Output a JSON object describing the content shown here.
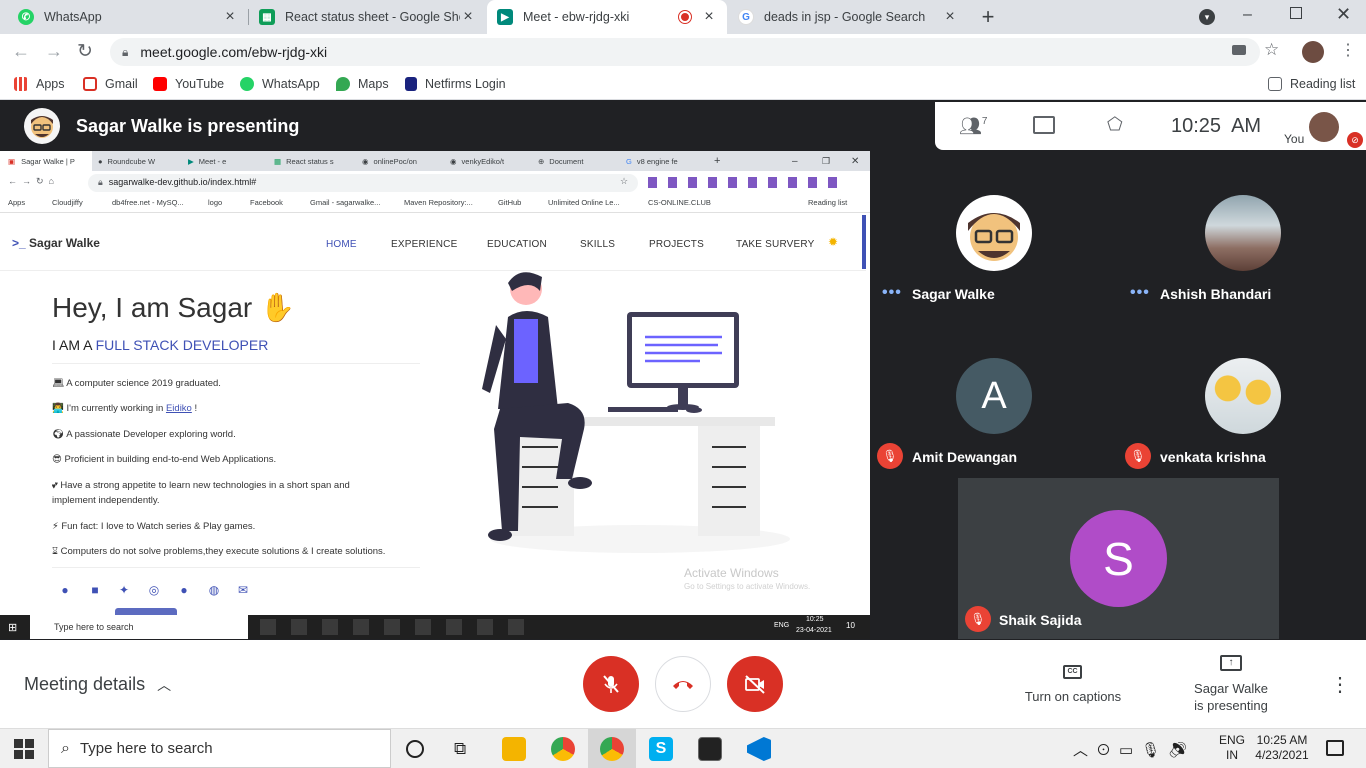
{
  "browser": {
    "tabs": [
      {
        "title": "WhatsApp",
        "icon": "whatsapp-icon",
        "color": "#25d366"
      },
      {
        "title": "React status sheet - Google Shee",
        "icon": "sheets-icon",
        "color": "#0f9d58"
      },
      {
        "title": "Meet - ebw-rjdg-xki",
        "icon": "meet-icon",
        "color": "#00897b"
      },
      {
        "title": "deads in jsp - Google Search",
        "icon": "google-icon",
        "color": "#4285f4"
      }
    ],
    "url": "meet.google.com/ebw-rjdg-xki",
    "bookmarks": [
      {
        "label": "Apps",
        "icon": "apps-grid-icon",
        "color": "#ea4335"
      },
      {
        "label": "Gmail",
        "icon": "gmail-icon",
        "color": "#d93025"
      },
      {
        "label": "YouTube",
        "icon": "youtube-icon",
        "color": "#ff0000"
      },
      {
        "label": "WhatsApp",
        "icon": "whatsapp-icon",
        "color": "#25d366"
      },
      {
        "label": "Maps",
        "icon": "maps-pin-icon",
        "color": "#34a853"
      },
      {
        "label": "Netfirms Login",
        "icon": "netfirms-icon",
        "color": "#1a237e"
      }
    ],
    "reading_list": "Reading list"
  },
  "meet": {
    "presenting_title": "Sagar Walke is presenting",
    "participant_count": "7",
    "time": "10:25",
    "ampm": "AM",
    "you_label": "You",
    "participants": [
      {
        "name": "Sagar Walke",
        "initial": "",
        "status": "speaking"
      },
      {
        "name": "Ashish Bhandari",
        "initial": "",
        "status": "speaking"
      },
      {
        "name": "Amit Dewangan",
        "initial": "A",
        "status": "muted"
      },
      {
        "name": "venkata krishna",
        "initial": "",
        "status": "muted"
      },
      {
        "name": "Shaik Sajida",
        "initial": "S",
        "status": "muted"
      }
    ],
    "meeting_details": "Meeting details",
    "captions_label": "Turn on captions",
    "presenting_label_1": "Sagar Walke",
    "presenting_label_2": "is presenting"
  },
  "shared": {
    "tabs": [
      "Sagar Walke | P",
      "Roundcube W",
      "Meet - e",
      "React status s",
      "onlinePoc/on",
      "venkyEdiko/t",
      "Document",
      "v8 engine fe"
    ],
    "url": "sagarwalke-dev.github.io/index.html#",
    "bookmarks": [
      "Apps",
      "Cloudjiffy",
      "db4free.net - MySQ...",
      "logo",
      "Facebook",
      "Gmail - sagarwalke...",
      "Maven Repository:...",
      "GitHub",
      "Unlimited Online Le...",
      "CS-ONLINE.CLUB"
    ],
    "reading_list": "Reading list",
    "site": {
      "brand": "Sagar Walke",
      "brand_prefix": ">_",
      "nav": [
        "HOME",
        "EXPERIENCE",
        "EDUCATION",
        "SKILLS",
        "PROJECTS",
        "TAKE SURVERY"
      ],
      "heading": "Hey, I am Sagar",
      "role_prefix": "I AM A",
      "role": "FULL STACK DEVELOPER",
      "facts": [
        "A computer science 2019 graduated.",
        "I'm currently working in",
        "A passionate Developer exploring world.",
        "Proficient in building end-to-end Web Applications.",
        "Have a strong appetite to learn new technologies in a short span and implement independently.",
        "Fun fact: I love to Watch series & Play games.",
        "Computers do not solve problems,they execute solutions & I create solutions."
      ],
      "company": "Eidiko",
      "company_suffix": " !",
      "watermark_1": "Activate Windows",
      "watermark_2": "Go to Settings to activate Windows."
    },
    "taskbar": {
      "search": "Type here to search",
      "lang": "ENG",
      "time": "10:25",
      "date": "23-04-2021",
      "notif": "10"
    }
  },
  "taskbar": {
    "search": "Type here to search",
    "lang_1": "ENG",
    "lang_2": "IN",
    "time": "10:25 AM",
    "date": "4/23/2021"
  },
  "colors": {
    "accent": "#1a73e8",
    "danger": "#d93025",
    "purple": "#5c6bc0"
  }
}
